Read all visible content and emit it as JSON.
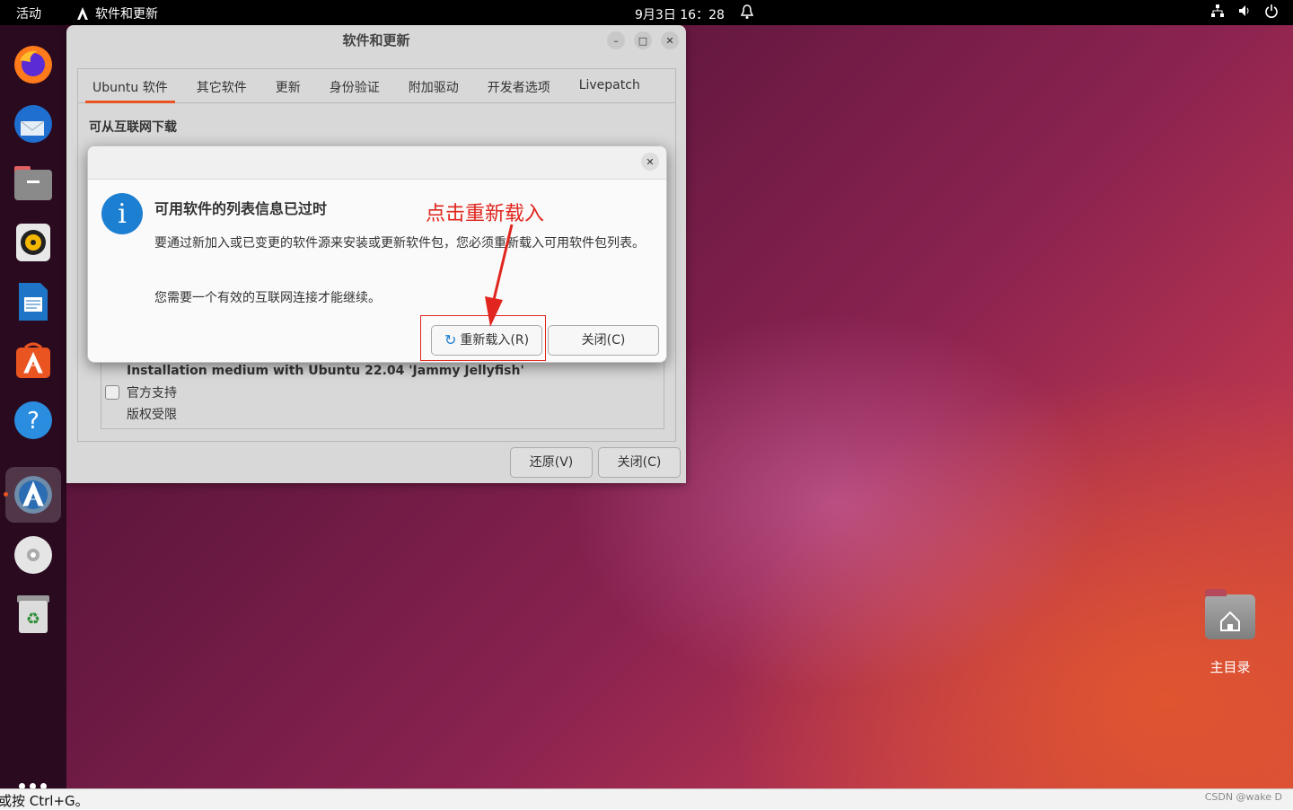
{
  "topbar": {
    "activities": "活动",
    "app_name": "软件和更新",
    "datetime": "9月3日  16：28"
  },
  "dock": {
    "items": [
      "firefox-icon",
      "thunderbird-icon",
      "files-icon",
      "rhythmbox-icon",
      "libreoffice-writer-icon",
      "app-center-icon",
      "help-icon",
      "software-updater-icon",
      "cd-drive-icon",
      "trash-icon"
    ]
  },
  "desktop": {
    "home_label": "主目录"
  },
  "window": {
    "title": "软件和更新",
    "tabs": [
      "Ubuntu 软件",
      "其它软件",
      "更新",
      "身份验证",
      "附加驱动",
      "开发者选项",
      "Livepatch"
    ],
    "section_title": "可从互联网下载",
    "media_title": "Installation medium with Ubuntu 22.04 'Jammy Jellyfish'",
    "official_support": "官方支持",
    "restricted": "版权受限",
    "revert_label": "还原(V)",
    "close_label": "关闭(C)"
  },
  "dialog": {
    "heading": "可用软件的列表信息已过时",
    "body": "要通过新加入或已变更的软件源来安装或更新软件包，您必须重新载入可用软件包列表。",
    "body2": "您需要一个有效的互联网连接才能继续。",
    "reload_label": "重新载入(R)",
    "close_label": "关闭(C)"
  },
  "annotation": {
    "text": "点击重新载入",
    "color": "#e0261e"
  },
  "statusbar": {
    "hint": "或按 Ctrl+G。",
    "watermark": "CSDN @wake D"
  },
  "colors": {
    "accent": "#e95420",
    "info_blue": "#1d7fd1"
  }
}
